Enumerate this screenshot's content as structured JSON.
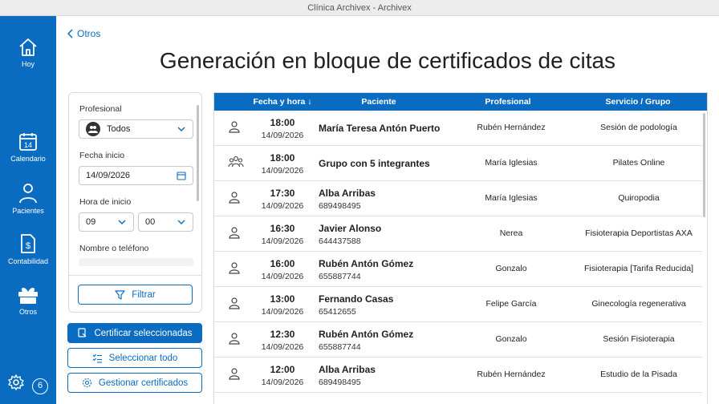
{
  "window": {
    "title": "Clínica Archivex - Archivex"
  },
  "sidebar": {
    "items": [
      {
        "label": "Hoy",
        "icon": "home-icon"
      },
      {
        "label": "Calendario",
        "icon": "calendar-icon",
        "day": "14"
      },
      {
        "label": "Pacientes",
        "icon": "person-icon"
      },
      {
        "label": "Contabilidad",
        "icon": "accounting-icon"
      },
      {
        "label": "Otros",
        "icon": "gift-icon"
      }
    ],
    "badge_count": "6"
  },
  "header": {
    "back_label": "Otros",
    "title": "Generación en bloque de certificados de citas"
  },
  "filters": {
    "profesional_label": "Profesional",
    "profesional_value": "Todos",
    "fecha_label": "Fecha inicio",
    "fecha_value": "14/09/2026",
    "hora_label": "Hora de inicio",
    "hora_value": "09",
    "minuto_value": "00",
    "nombre_label": "Nombre o teléfono",
    "filter_button": "Filtrar"
  },
  "actions": {
    "certify": "Certificar seleccionadas",
    "select_all": "Seleccionar todo",
    "manage": "Gestionar certificados"
  },
  "table": {
    "headers": {
      "fecha": "Fecha y hora",
      "paciente": "Paciente",
      "profesional": "Profesional",
      "servicio": "Servicio / Grupo"
    },
    "rows": [
      {
        "time": "18:00",
        "date": "14/09/2026",
        "name": "María Teresa Antón Puerto",
        "phone": "",
        "prof": "Rubén Hernández",
        "serv": "Sesión de podología",
        "icon": "person-icon"
      },
      {
        "time": "18:00",
        "date": "14/09/2026",
        "name": "Grupo con 5 integrantes",
        "phone": "",
        "prof": "María Iglesias",
        "serv": "Pilates Online",
        "icon": "group-icon"
      },
      {
        "time": "17:30",
        "date": "14/09/2026",
        "name": "Alba Arribas",
        "phone": "689498495",
        "prof": "María Iglesias",
        "serv": "Quiropodia",
        "icon": "person-icon"
      },
      {
        "time": "16:30",
        "date": "14/09/2026",
        "name": "Javier Alonso",
        "phone": "644437588",
        "prof": "Nerea",
        "serv": "Fisioterapia Deportistas AXA",
        "icon": "person-icon"
      },
      {
        "time": "16:00",
        "date": "14/09/2026",
        "name": "Rubén Antón Gómez",
        "phone": "655887744",
        "prof": "Gonzalo",
        "serv": "Fisioterapia [Tarifa Reducida]",
        "icon": "person-icon"
      },
      {
        "time": "13:00",
        "date": "14/09/2026",
        "name": "Fernando Casas",
        "phone": "65412655",
        "prof": "Felipe García",
        "serv": "Ginecología regenerativa",
        "icon": "person-icon"
      },
      {
        "time": "12:30",
        "date": "14/09/2026",
        "name": "Rubén Antón Gómez",
        "phone": "655887744",
        "prof": "Gonzalo",
        "serv": "Sesión Fisioterapia",
        "icon": "person-icon"
      },
      {
        "time": "12:00",
        "date": "14/09/2026",
        "name": "Alba Arribas",
        "phone": "689498495",
        "prof": "Rubén Hernández",
        "serv": "Estudio de la Pisada",
        "icon": "person-icon"
      }
    ]
  },
  "colors": {
    "accent": "#0a6cc0"
  }
}
